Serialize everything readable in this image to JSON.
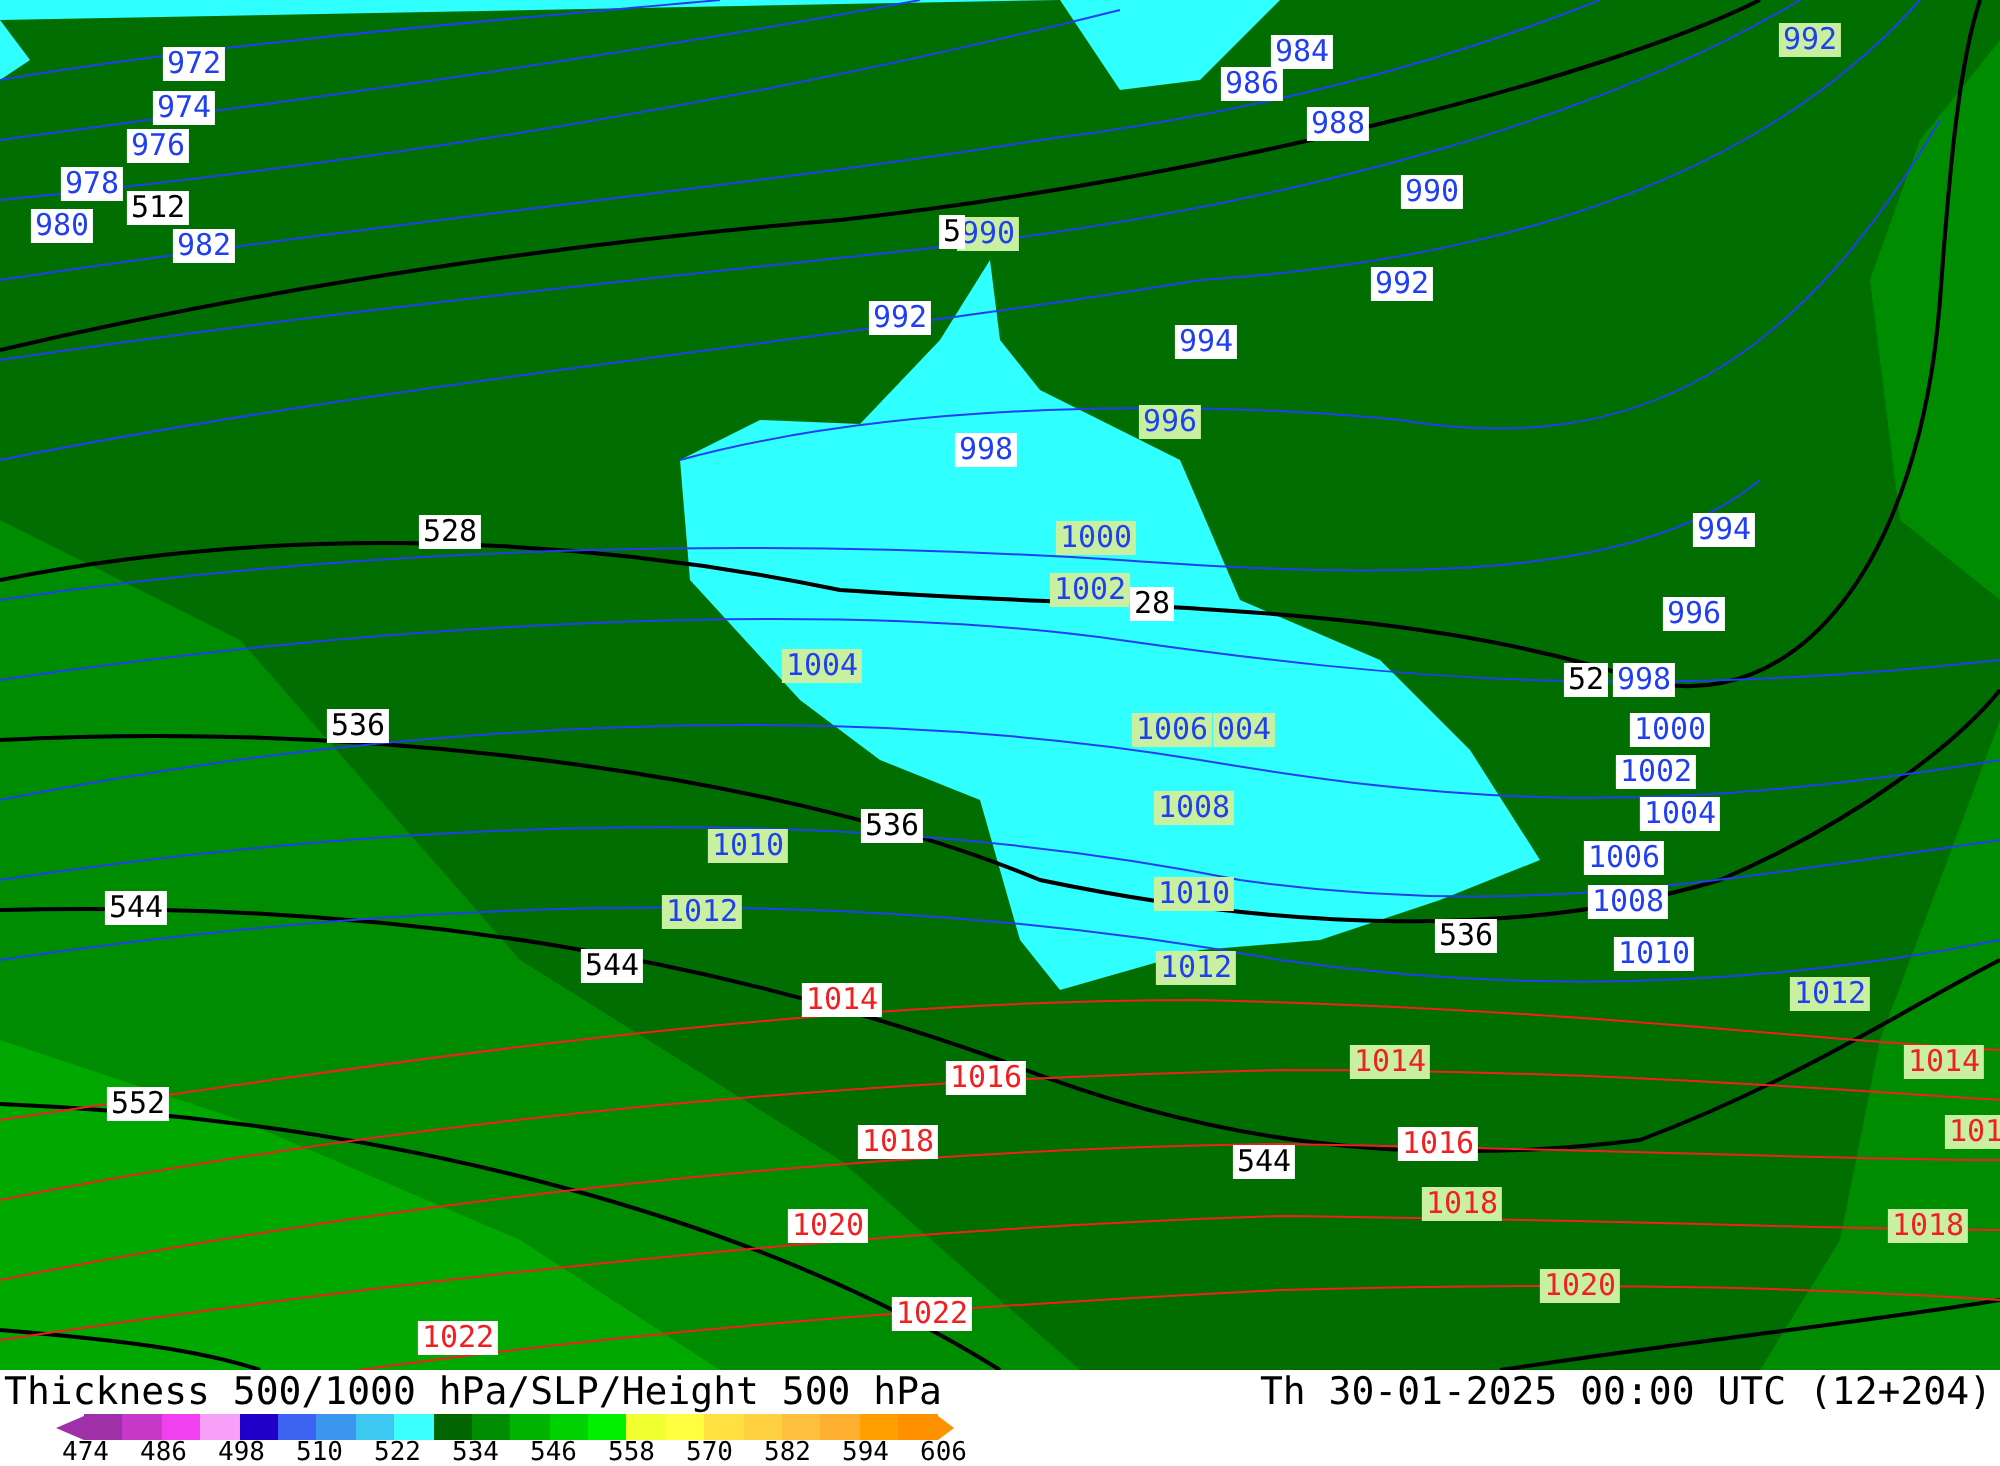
{
  "map": {
    "labels": [
      {
        "text": "972",
        "kind": "isobar"
      },
      {
        "text": "974",
        "kind": "isobar"
      },
      {
        "text": "976",
        "kind": "isobar"
      },
      {
        "text": "978",
        "kind": "isobar"
      },
      {
        "text": "980",
        "kind": "isobar"
      },
      {
        "text": "982",
        "kind": "isobar"
      },
      {
        "text": "984",
        "kind": "isobar"
      },
      {
        "text": "986",
        "kind": "isobar"
      },
      {
        "text": "988",
        "kind": "isobar"
      },
      {
        "text": "990",
        "kind": "isobar"
      },
      {
        "text": "992",
        "kind": "isobar"
      },
      {
        "text": "992",
        "kind": "isobar"
      },
      {
        "text": "994",
        "kind": "isobar"
      },
      {
        "text": "998",
        "kind": "isobar"
      },
      {
        "text": "994",
        "kind": "isobar"
      },
      {
        "text": "996",
        "kind": "isobar"
      },
      {
        "text": "998",
        "kind": "isobar"
      },
      {
        "text": "1000",
        "kind": "isobar"
      },
      {
        "text": "1002",
        "kind": "isobar"
      },
      {
        "text": "1004",
        "kind": "isobar"
      },
      {
        "text": "1006",
        "kind": "isobar"
      },
      {
        "text": "1008",
        "kind": "isobar"
      },
      {
        "text": "1010",
        "kind": "isobar"
      },
      {
        "text": "992",
        "kind": "isobar-marked"
      },
      {
        "text": "990",
        "kind": "isobar-marked"
      },
      {
        "text": "996",
        "kind": "isobar-marked"
      },
      {
        "text": "1000",
        "kind": "isobar-marked"
      },
      {
        "text": "1002",
        "kind": "isobar-marked"
      },
      {
        "text": "1004",
        "kind": "isobar-marked"
      },
      {
        "text": "1006",
        "kind": "isobar-marked"
      },
      {
        "text": "004",
        "kind": "isobar-marked"
      },
      {
        "text": "1008",
        "kind": "isobar-marked"
      },
      {
        "text": "1010",
        "kind": "isobar-marked"
      },
      {
        "text": "1012",
        "kind": "isobar-marked"
      },
      {
        "text": "1010",
        "kind": "isobar-marked"
      },
      {
        "text": "1012",
        "kind": "isobar-marked"
      },
      {
        "text": "1012",
        "kind": "isobar-marked"
      },
      {
        "text": "1014",
        "kind": "high-isobar"
      },
      {
        "text": "1016",
        "kind": "high-isobar"
      },
      {
        "text": "1018",
        "kind": "high-isobar"
      },
      {
        "text": "1016",
        "kind": "high-isobar"
      },
      {
        "text": "1020",
        "kind": "high-isobar"
      },
      {
        "text": "1022",
        "kind": "high-isobar"
      },
      {
        "text": "1022",
        "kind": "high-isobar"
      },
      {
        "text": "1014",
        "kind": "high-isobar-marked"
      },
      {
        "text": "1014",
        "kind": "high-isobar-marked"
      },
      {
        "text": "1018",
        "kind": "high-isobar-marked"
      },
      {
        "text": "1018",
        "kind": "high-isobar-marked"
      },
      {
        "text": "1020",
        "kind": "high-isobar-marked"
      },
      {
        "text": "101",
        "kind": "high-isobar-marked"
      },
      {
        "text": "512",
        "kind": "thickness"
      },
      {
        "text": "528",
        "kind": "thickness"
      },
      {
        "text": "28",
        "kind": "thickness"
      },
      {
        "text": "52",
        "kind": "thickness"
      },
      {
        "text": "536",
        "kind": "thickness"
      },
      {
        "text": "536",
        "kind": "thickness"
      },
      {
        "text": "536",
        "kind": "thickness"
      },
      {
        "text": "544",
        "kind": "thickness"
      },
      {
        "text": "544",
        "kind": "thickness"
      },
      {
        "text": "544",
        "kind": "thickness"
      },
      {
        "text": "552",
        "kind": "thickness"
      },
      {
        "text": "5",
        "kind": "thickness"
      }
    ]
  },
  "title": "Thickness 500/1000 hPa/SLP/Height 500 hPa",
  "valid_time": "Th 30-01-2025 00:00 UTC (12+204)",
  "legend": {
    "swatches": [
      {
        "color": "#a030a8"
      },
      {
        "color": "#c838c8"
      },
      {
        "color": "#f040f0"
      },
      {
        "color": "#f8a0f8"
      },
      {
        "color": "#2000c8"
      },
      {
        "color": "#3c64f0"
      },
      {
        "color": "#3c96f0"
      },
      {
        "color": "#3cc8f0"
      },
      {
        "color": "#3cffff"
      },
      {
        "color": "#006400"
      },
      {
        "color": "#008c00"
      },
      {
        "color": "#00b400"
      },
      {
        "color": "#00d200"
      },
      {
        "color": "#00f000"
      },
      {
        "color": "#f0ff30"
      },
      {
        "color": "#ffff40"
      },
      {
        "color": "#ffe040"
      },
      {
        "color": "#ffd040"
      },
      {
        "color": "#ffc040"
      },
      {
        "color": "#ffb030"
      },
      {
        "color": "#ffa000"
      },
      {
        "color": "#ff9000"
      }
    ],
    "ticks": [
      "474",
      "486",
      "498",
      "510",
      "522",
      "534",
      "546",
      "558",
      "570",
      "582",
      "594",
      "606"
    ]
  }
}
